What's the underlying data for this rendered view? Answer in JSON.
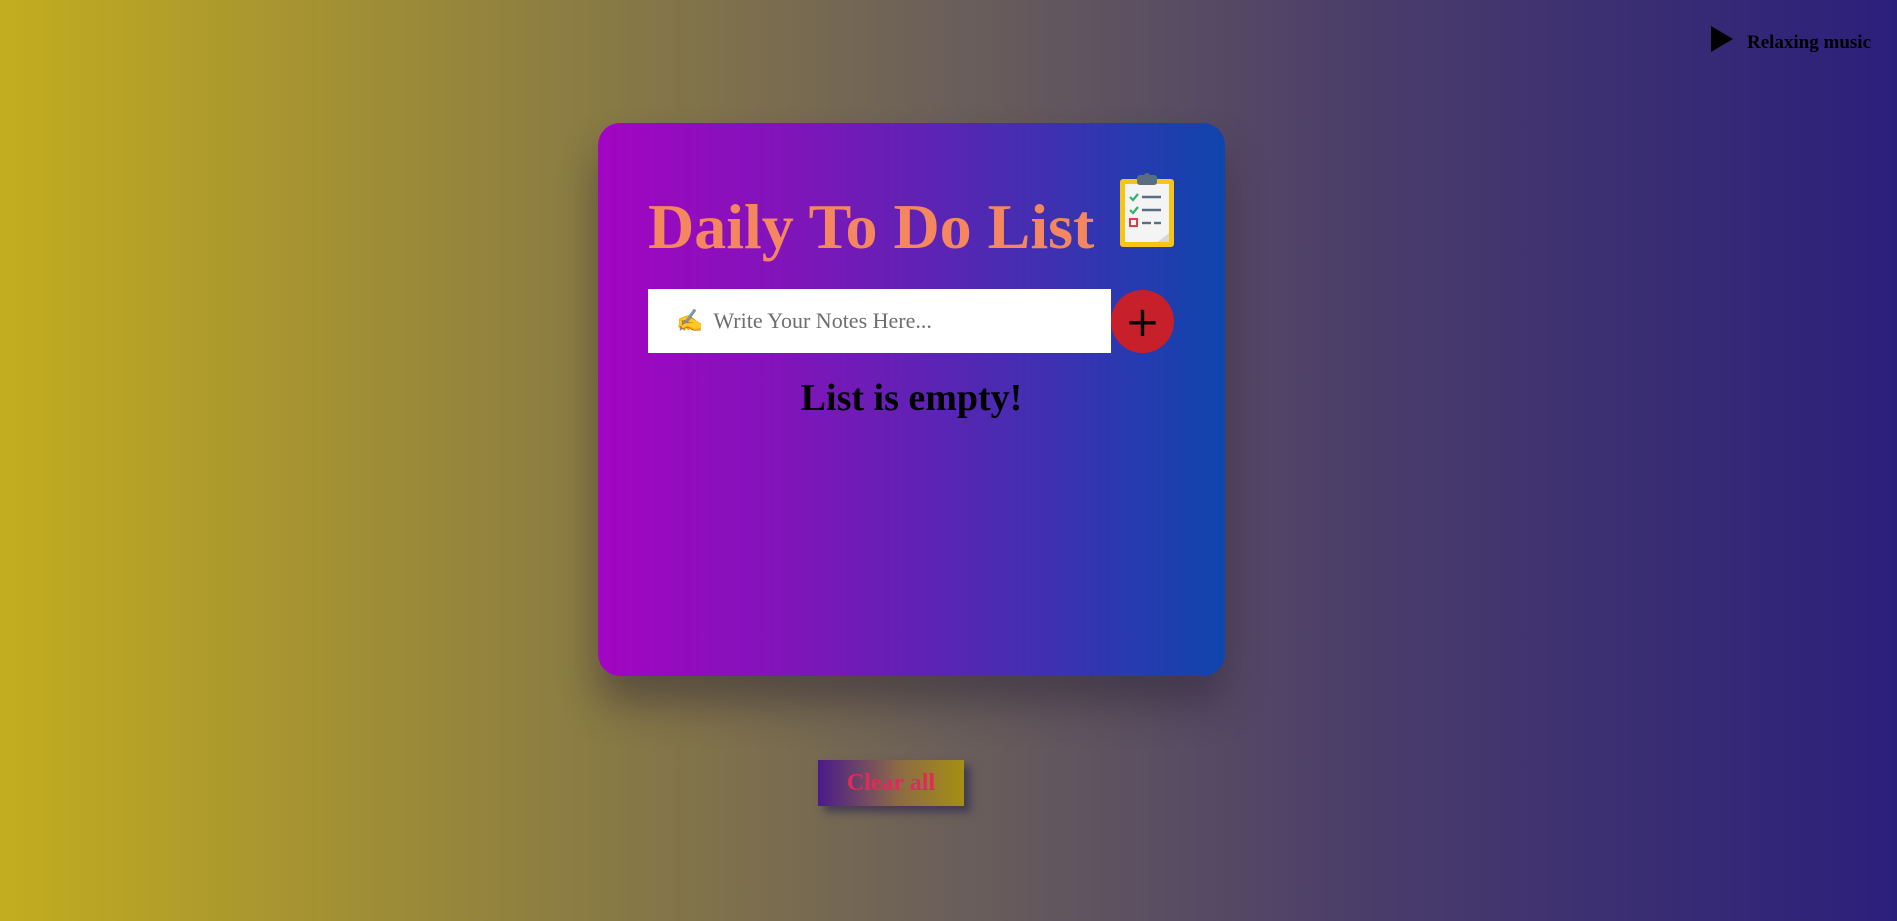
{
  "music": {
    "icon": "play-icon",
    "label": "Relaxing music"
  },
  "card": {
    "title": "Daily To Do List",
    "title_icon": "clipboard-icon",
    "input": {
      "icon": "✍️",
      "placeholder": "Write Your Notes Here...",
      "value": ""
    },
    "add_button_label": "+",
    "empty_message": "List is empty!"
  },
  "clear_button_label": "Clear all",
  "colors": {
    "title": "#f4875f",
    "add_button": "#c8202b",
    "clear_text": "#e2295c"
  }
}
